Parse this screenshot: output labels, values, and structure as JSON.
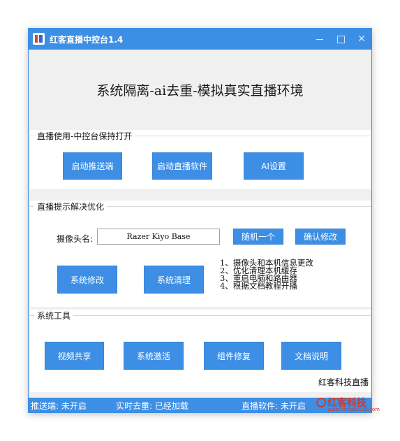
{
  "window": {
    "title": "红客直播中控台1.4",
    "close_glyph": "✕"
  },
  "main_title": "系统隔离-ai去重-模拟真实直播环境",
  "group_live": {
    "title": "直播使用-中控台保持打开",
    "buttons": [
      "启动推送端",
      "启动直播软件",
      "AI设置"
    ]
  },
  "group_tips": {
    "title": "直播提示解决优化",
    "camera_label": "摄像头名:",
    "camera_value": "Razer Kiyo Base",
    "random_button": "随机一个",
    "confirm_button": "确认修改",
    "modify_button": "系统修改",
    "clean_button": "系统清理",
    "tips": [
      "1、摄像头和本机信息更改",
      "2、优化清理本机缓存",
      "3、重启电脑和路由器",
      "4、根据文档教程开播"
    ]
  },
  "group_tools": {
    "title": "系统工具",
    "buttons": [
      "视频共享",
      "系统激活",
      "组件修复",
      "文档说明"
    ],
    "brand": "红客科技直播"
  },
  "status": {
    "pusher": "推送端: 未开启",
    "dedupe": "实时去重: 已经加载",
    "live_software": "直播软件: 未开启"
  },
  "watermark": {
    "name": "红客科技",
    "url": "www.hongke158.com"
  },
  "colors": {
    "accent": "#3d8fe6",
    "watermark": "#d03a2f"
  }
}
